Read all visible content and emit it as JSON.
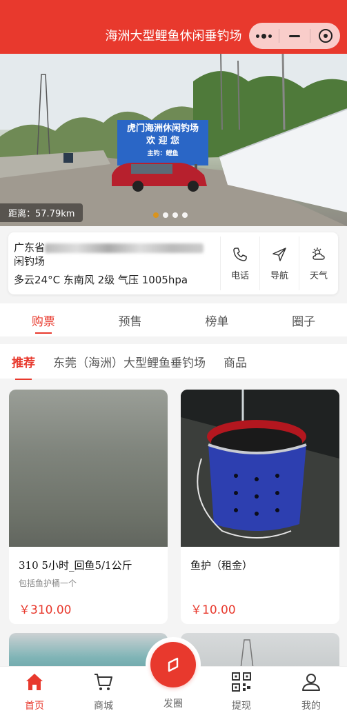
{
  "header": {
    "title": "海洲大型鲤鱼休闲垂钓场"
  },
  "banner": {
    "sign_line1": "虎门海洲休闲钓场",
    "sign_line2": "欢 迎 您",
    "sign_line3": "主钓：鲤鱼",
    "distance": "距离：57.79km",
    "indicator_active": 0,
    "indicator_count": 4
  },
  "info": {
    "address_prefix": "广东省",
    "address_suffix": "闲钓场",
    "weather": "多云24°C  东南风 2级 气压 1005hpa",
    "actions": [
      {
        "label": "电话",
        "icon": "phone-icon"
      },
      {
        "label": "导航",
        "icon": "navigation-icon"
      },
      {
        "label": "天气",
        "icon": "weather-icon"
      }
    ]
  },
  "tabs": [
    {
      "label": "购票",
      "active": true
    },
    {
      "label": "预售",
      "active": false
    },
    {
      "label": "榜单",
      "active": false
    },
    {
      "label": "圈子",
      "active": false
    }
  ],
  "subtabs": [
    {
      "label": "推荐",
      "active": true
    },
    {
      "label": "东莞（海洲）大型鲤鱼垂钓场",
      "active": false
    },
    {
      "label": "商品",
      "active": false
    }
  ],
  "products": [
    {
      "name": "310 5小时_回鱼5/1公斤",
      "desc": "包括鱼护桶一个",
      "price": "￥310.00"
    },
    {
      "name": "鱼护（租金）",
      "desc": "",
      "price": "￥10.00"
    }
  ],
  "bottomnav": [
    {
      "label": "首页",
      "icon": "home-icon",
      "active": true
    },
    {
      "label": "商城",
      "icon": "cart-icon",
      "active": false
    },
    {
      "label": "发圈",
      "icon": "compass-icon",
      "active": false
    },
    {
      "label": "提现",
      "icon": "qrcode-icon",
      "active": false
    },
    {
      "label": "我的",
      "icon": "user-icon",
      "active": false
    }
  ],
  "colors": {
    "brand": "#e8392d",
    "indicator_active": "#d9941e"
  }
}
